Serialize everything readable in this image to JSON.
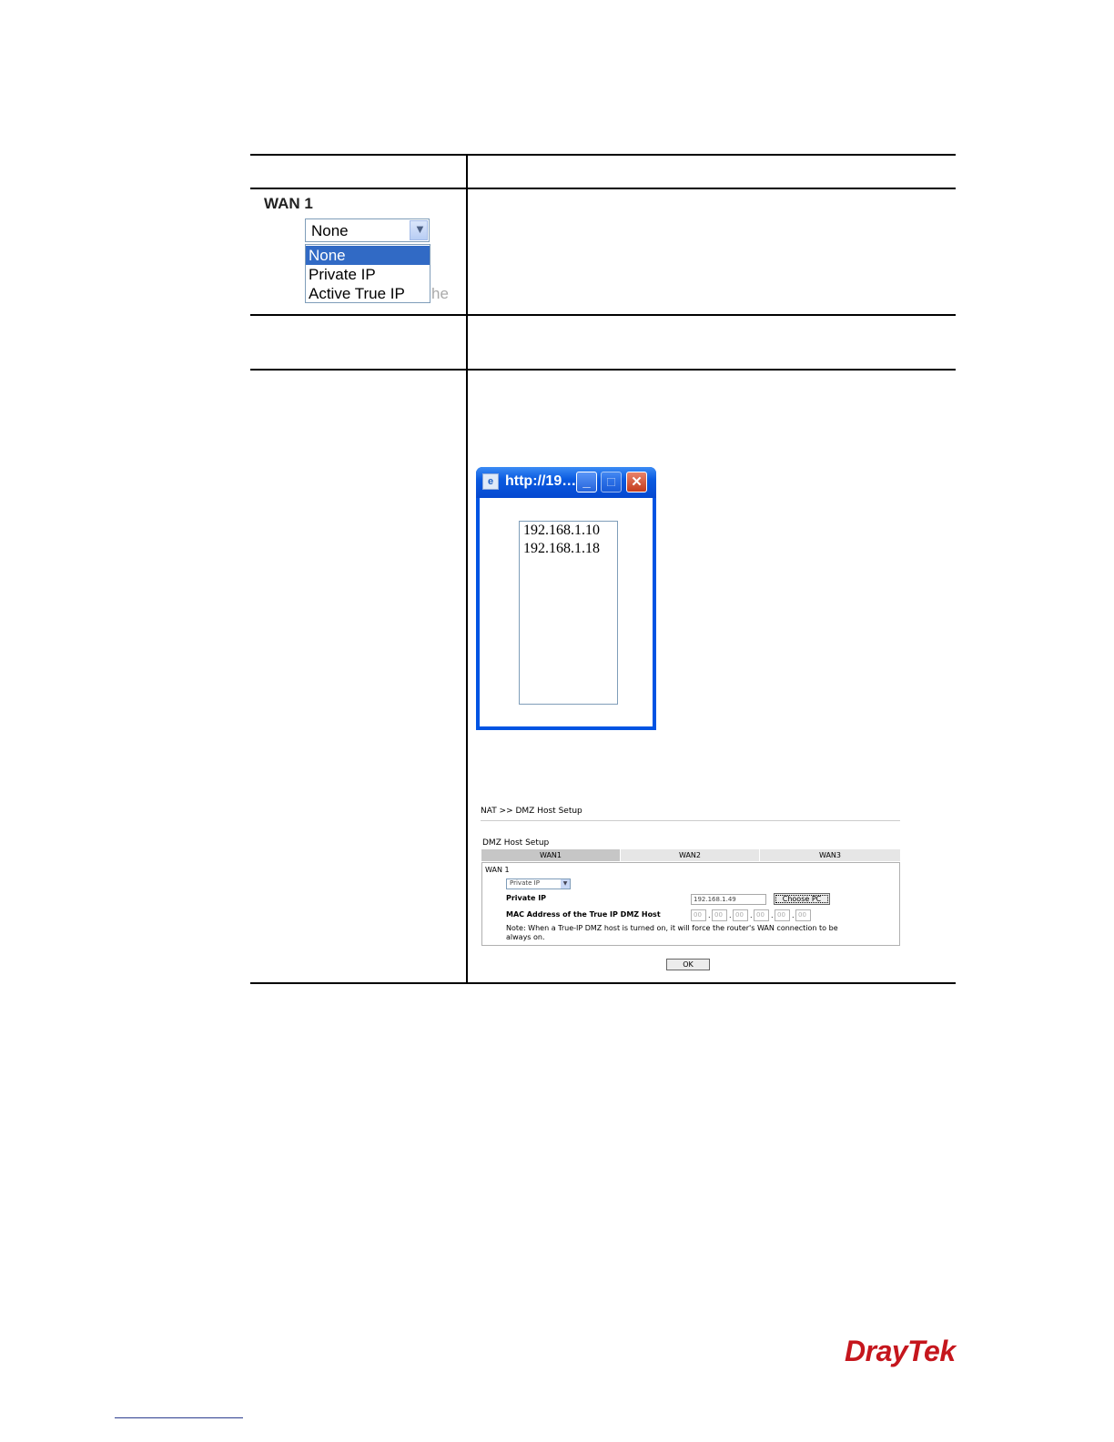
{
  "wan1_dropdown": {
    "label": "WAN 1",
    "selected": "None",
    "options": [
      "None",
      "Private IP",
      "Active True IP"
    ],
    "ghost_text": "he"
  },
  "popup": {
    "title": "http://19…",
    "ip_list": [
      "192.168.1.10",
      "192.168.1.18"
    ]
  },
  "dmz_setup": {
    "breadcrumb": "NAT >> DMZ Host Setup",
    "title": "DMZ Host Setup",
    "tabs": [
      "WAN1",
      "WAN2",
      "WAN3"
    ],
    "section": "WAN 1",
    "mode_select": "Private IP",
    "private_ip_label": "Private IP",
    "private_ip_value": "192.168.1.49",
    "choose_pc_label": "Choose PC",
    "mac_label": "MAC Address of the True IP DMZ Host",
    "mac_fields": [
      "00",
      "00",
      "00",
      "00",
      "00",
      "00"
    ],
    "note_line1": "Note: When a True-IP DMZ host is turned on, it will force the router's WAN connection to be",
    "note_line2": "always on.",
    "ok_label": "OK"
  },
  "logo": "DrayTek"
}
